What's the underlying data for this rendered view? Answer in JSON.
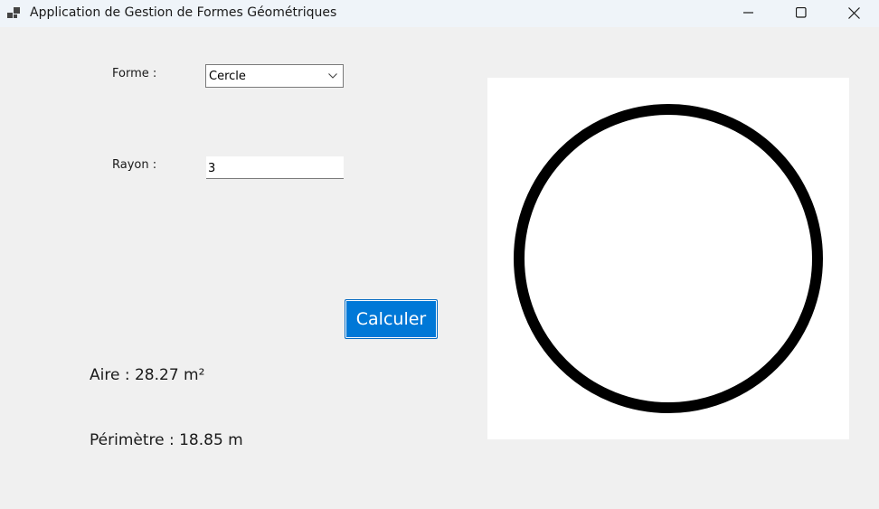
{
  "window": {
    "title": "Application de Gestion de Formes Géométriques",
    "app_icon": "app-window-icon",
    "controls": [
      "minimize-icon",
      "maximize-icon",
      "close-icon"
    ]
  },
  "form": {
    "shape_label": "Forme :",
    "shape_value": "Cercle",
    "radius_label": "Rayon :",
    "radius_value": "3",
    "calculate_label": "Calculer"
  },
  "results": {
    "area": "Aire : 28.27 m²",
    "perimeter": "Périmètre : 18.85 m"
  },
  "drawing": {
    "shape": "circle",
    "background": "#ffffff",
    "stroke_color": "#000000"
  },
  "colors": {
    "accent": "#0078d7",
    "window_bg": "#f0f0f0"
  }
}
